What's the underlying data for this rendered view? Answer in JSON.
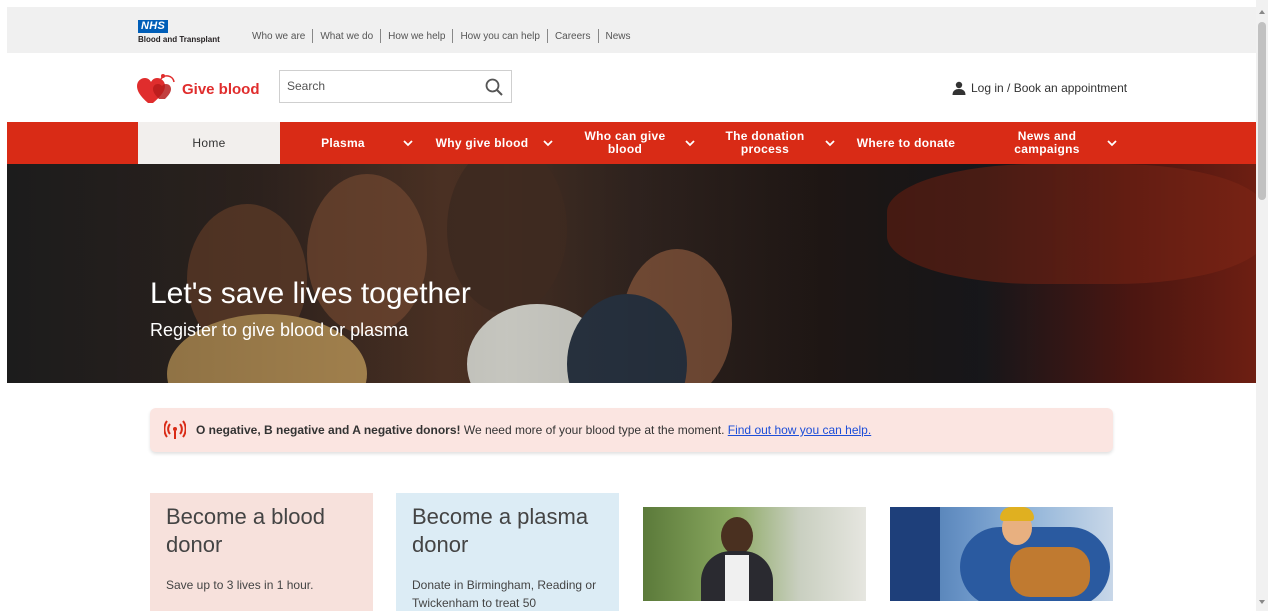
{
  "topbar": {
    "nhs_logo": "NHS",
    "nhs_subtitle": "Blood and Transplant",
    "links": [
      "Who we are",
      "What we do",
      "How we help",
      "How you can help",
      "Careers",
      "News"
    ]
  },
  "header": {
    "brand": "Give blood",
    "search": {
      "placeholder": "Search",
      "value": ""
    },
    "search_icon": "search-icon",
    "login_icon": "user-icon",
    "login_label": "Log in / Book an appointment"
  },
  "nav": {
    "items": [
      {
        "label": "Home",
        "has_dropdown": false,
        "active": true
      },
      {
        "label": "Plasma",
        "has_dropdown": true
      },
      {
        "label": "Why give blood",
        "has_dropdown": true
      },
      {
        "label": "Who can give blood",
        "has_dropdown": true
      },
      {
        "label": "The donation process",
        "has_dropdown": true
      },
      {
        "label": "Where to donate",
        "has_dropdown": false
      },
      {
        "label": "News and campaigns",
        "has_dropdown": true
      }
    ]
  },
  "hero": {
    "title": "Let's save lives together",
    "subtitle": "Register to give blood or plasma"
  },
  "alert": {
    "icon": "broadcast-icon",
    "bold": "O negative, B negative and A negative donors!",
    "text": " We need more of your blood type at the moment. ",
    "link": "Find out how you can help."
  },
  "cards": [
    {
      "title": "Become a blood donor",
      "desc": "Save up to 3 lives in 1 hour."
    },
    {
      "title": "Become a plasma donor",
      "desc": "Donate in Birmingham, Reading or Twickenham to treat 50"
    }
  ],
  "colors": {
    "brand_red": "#d92b16",
    "nhs_blue": "#005eb8",
    "link_blue": "#1d4ed8",
    "blood_card": "#f7e1dc",
    "plasma_card": "#dcecf5"
  }
}
